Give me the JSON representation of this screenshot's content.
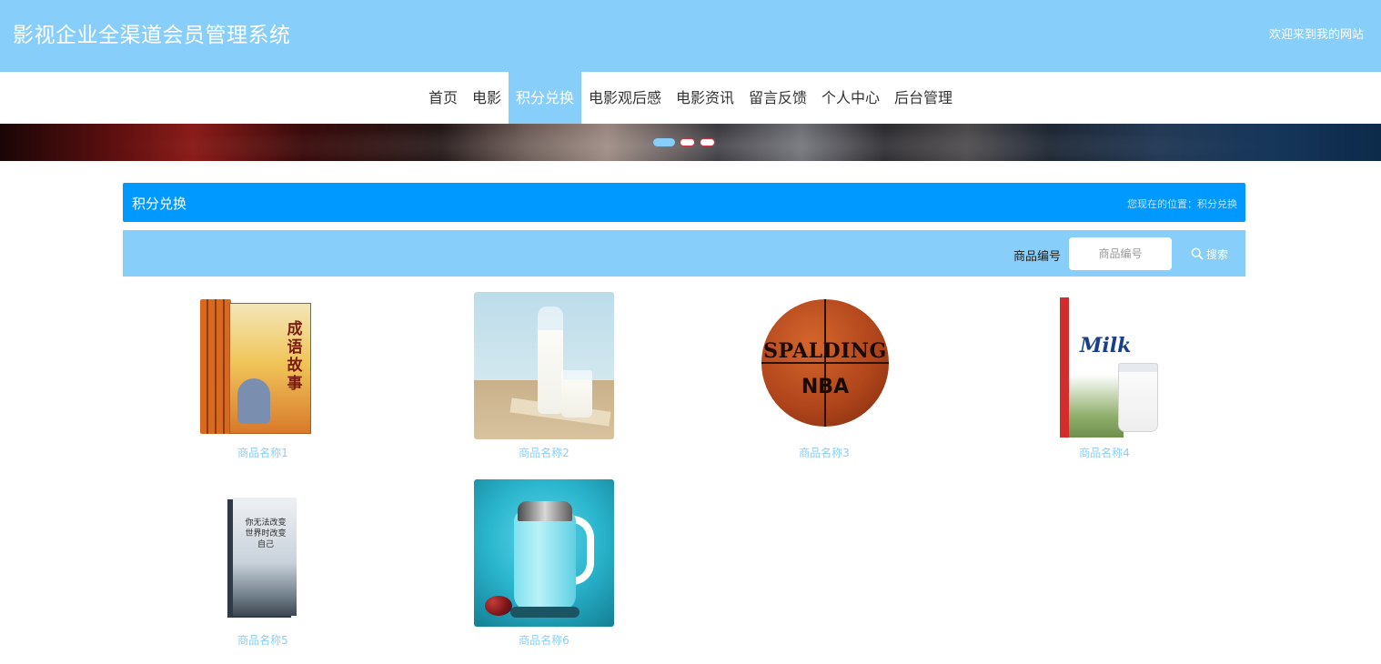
{
  "header": {
    "site_title": "影视企业全渠道会员管理系统",
    "welcome": "欢迎来到我的网站"
  },
  "nav": {
    "items": [
      {
        "label": "首页",
        "active": false
      },
      {
        "label": "电影",
        "active": false
      },
      {
        "label": "积分兑换",
        "active": true
      },
      {
        "label": "电影观后感",
        "active": false
      },
      {
        "label": "电影资讯",
        "active": false
      },
      {
        "label": "留言反馈",
        "active": false
      },
      {
        "label": "个人中心",
        "active": false
      },
      {
        "label": "后台管理",
        "active": false
      }
    ]
  },
  "banner": {
    "slides": 3,
    "active_slide": 1
  },
  "section": {
    "title": "积分兑换",
    "breadcrumb": "您现在的位置：积分兑换"
  },
  "search": {
    "label": "商品编号",
    "placeholder": "商品编号",
    "value": "",
    "button_label": "搜索",
    "button_icon": "search-icon"
  },
  "products": [
    {
      "name": "商品名称1",
      "image": "book-chengyu-gushi"
    },
    {
      "name": "商品名称2",
      "image": "milk-bottle-glass"
    },
    {
      "name": "商品名称3",
      "image": "spalding-basketball"
    },
    {
      "name": "商品名称4",
      "image": "milk-carton-glass"
    },
    {
      "name": "商品名称5",
      "image": "book-gaibian-ziji"
    },
    {
      "name": "商品名称6",
      "image": "electric-kettle"
    }
  ],
  "product_art": {
    "book1_text": "成语故事",
    "ball_brand": "SPALDING",
    "ball_league": "NBA",
    "carton_text": "Milk",
    "book2_text": "你无法改变世界时改变自己"
  },
  "colors": {
    "header_bg": "#87cefa",
    "title_bar_bg": "#0099ff",
    "product_name": "#87cefa"
  }
}
